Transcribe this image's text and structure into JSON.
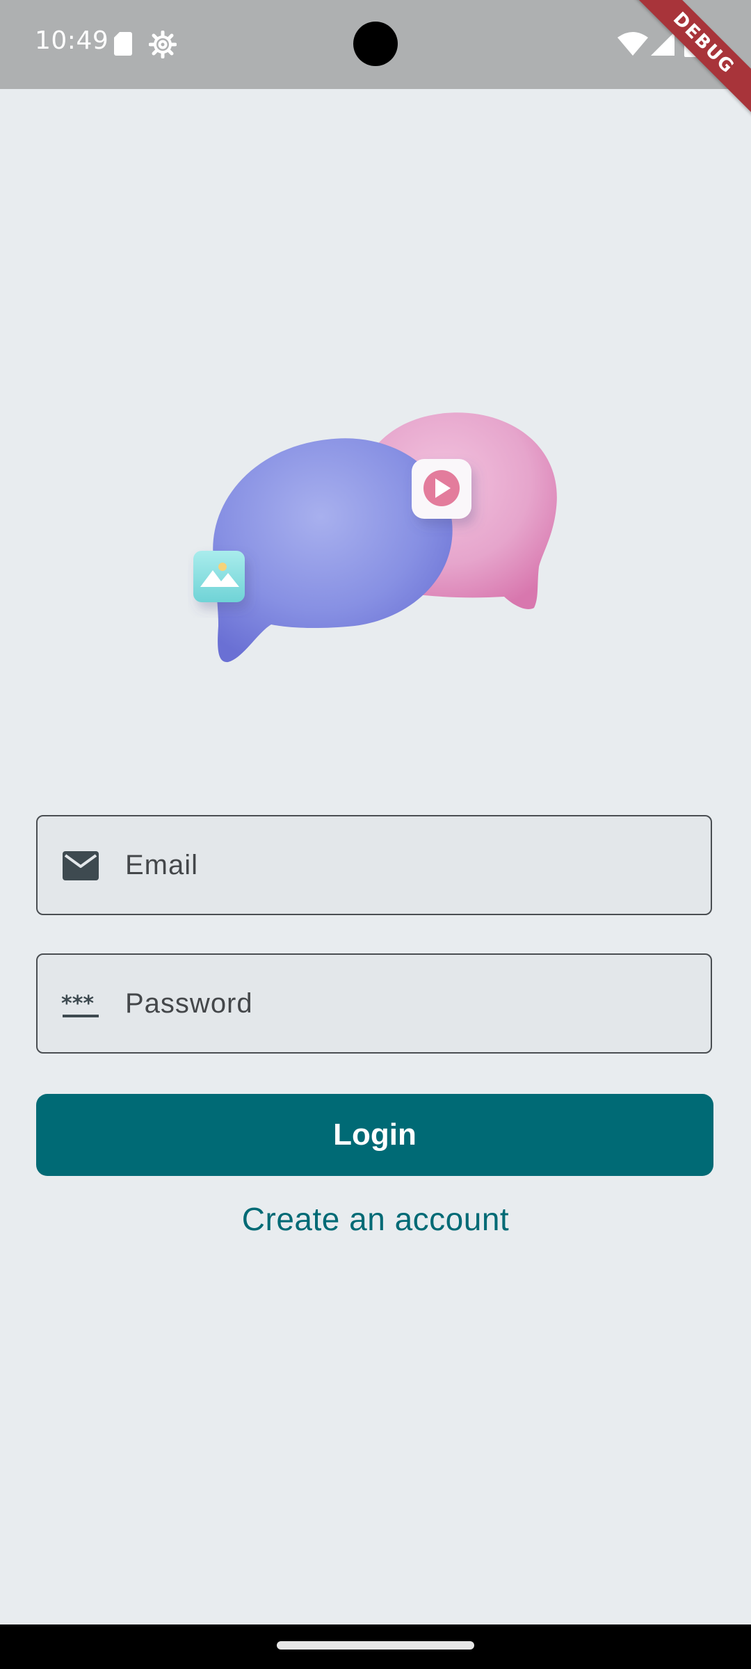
{
  "status_bar": {
    "time": "10:49",
    "icons": [
      "sd-card-icon",
      "settings-icon",
      "wifi-icon",
      "signal-icon",
      "battery-icon"
    ]
  },
  "debug_banner": {
    "label": "DEBUG"
  },
  "hero": {
    "icons": [
      "chat-bubbles-illustration",
      "image-icon",
      "play-icon"
    ]
  },
  "form": {
    "email": {
      "placeholder": "Email",
      "value": "",
      "icon": "mail-icon"
    },
    "password": {
      "placeholder": "Password",
      "value": "",
      "icon": "password-icon"
    }
  },
  "actions": {
    "login_label": "Login",
    "create_account_label": "Create an account"
  },
  "colors": {
    "background": "#E8ECEF",
    "status_bar": "#AEB0B1",
    "accent": "#006A75",
    "debug": "#A8343A",
    "bubble_blue": "#8A94E6",
    "bubble_pink": "#E9A3CC"
  }
}
